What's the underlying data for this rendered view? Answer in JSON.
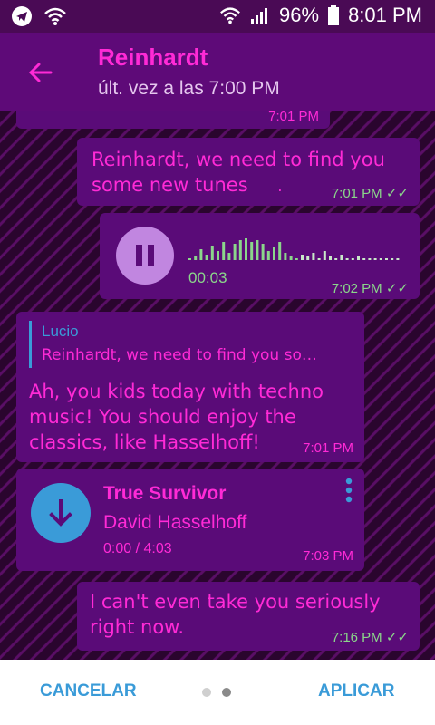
{
  "status": {
    "battery": "96%",
    "time": "8:01 PM"
  },
  "chat_header": {
    "name": "Reinhardt",
    "last_seen": "últ. vez a las 7:00 PM"
  },
  "messages": {
    "partial_time": "7:01 PM",
    "m1": {
      "text_line1": "Reinhardt, we need to find you",
      "text_line2": "some new tunes",
      "dot": ".",
      "time": "7:01 PM",
      "ticks": "✓✓"
    },
    "voice": {
      "elapsed": "00:03",
      "time": "7:02 PM",
      "ticks": "✓✓"
    },
    "reply": {
      "quote_author": "Lucio",
      "quote_text": "Reinhardt, we need to find you so…",
      "line1": "Ah, you kids today with techno",
      "line2": "music! You should enjoy the",
      "line3": "classics, like Hasselhoff!",
      "time": "7:01 PM"
    },
    "song": {
      "title": "True Survivor",
      "artist": "David Hasselhoff",
      "duration": "0:00 / 4:03",
      "time": "7:03 PM"
    },
    "m2": {
      "line1": "I can't even take you seriously",
      "line2": "right now.",
      "time": "7:16 PM",
      "ticks": "✓✓"
    }
  },
  "footer": {
    "cancel": "CANCELAR",
    "apply": "APLICAR"
  },
  "colors": {
    "accent": "#ff2ad6",
    "header_bg": "#5e0a78",
    "bubble_bg": "#5a0b78",
    "tick_green": "#8bd68b",
    "button_blue": "#3a9bd8"
  }
}
